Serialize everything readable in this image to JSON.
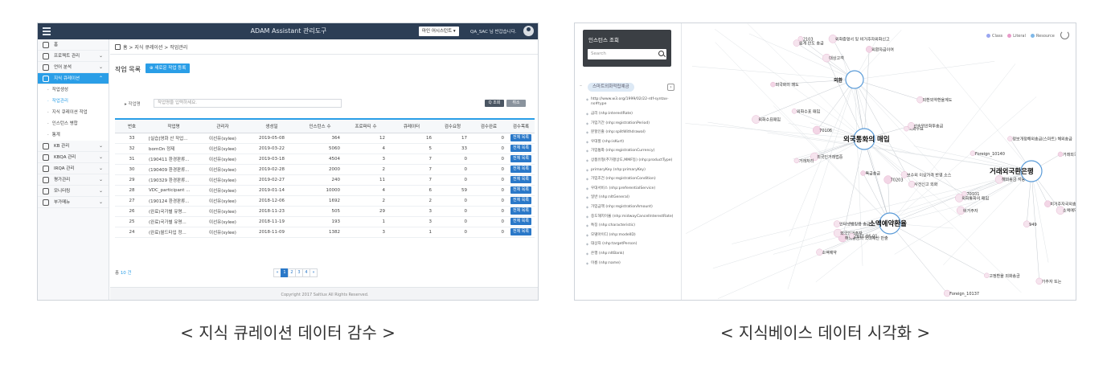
{
  "left_screen": {
    "app_title": "ADAM Assistant 관리도구",
    "assistant_select": "마인 어시스턴트 ▾",
    "user_greeting": "QA_SAC 님 반갑습니다.",
    "sidebar": [
      {
        "label": "홈",
        "chevron": ""
      },
      {
        "label": "프로젝트 관리",
        "chevron": "⌄"
      },
      {
        "label": "언어 분석",
        "chevron": "⌄"
      },
      {
        "label": "지식 큐레이션",
        "chevron": "⌃",
        "active": true
      },
      {
        "label": "작업생성",
        "sub": true
      },
      {
        "label": "작업관리",
        "sub": true,
        "current": true
      },
      {
        "label": "지식 큐레이션 작업",
        "sub": true
      },
      {
        "label": "인스턴스 병합",
        "sub": true
      },
      {
        "label": "통계",
        "sub": true
      },
      {
        "label": "KB 관리",
        "chevron": "⌄"
      },
      {
        "label": "KBQA 관리",
        "chevron": "⌄"
      },
      {
        "label": "IRQA 관리",
        "chevron": "⌄"
      },
      {
        "label": "평가관리",
        "chevron": "⌄"
      },
      {
        "label": "모니터링",
        "chevron": "⌄"
      },
      {
        "label": "부가메뉴",
        "chevron": "⌄"
      }
    ],
    "breadcrumb": "홈 > 지식 큐레이션 > 작업관리",
    "page_title": "작업 목록",
    "new_button": "⊕ 새로운 작업 등록",
    "filter_label": "작업명",
    "filter_placeholder": "작업명을 입력하세요.",
    "search_button": "Q 조회",
    "cancel_button": "취소",
    "table_headers": [
      "번호",
      "작업명",
      "관리자",
      "생성일",
      "인스턴스 수",
      "프로퍼티 수",
      "큐레이터",
      "검수요청",
      "검수완료",
      "검수목록"
    ],
    "rows": [
      [
        "33",
        "[실습]영화 산 작업...",
        "이선유(sylee)",
        "2019-05-08",
        "364",
        "12",
        "16",
        "17",
        "0",
        "전체 목록"
      ],
      [
        "32",
        "bornOn 정제",
        "이선유(sylee)",
        "2019-03-22",
        "5060",
        "4",
        "5",
        "33",
        "0",
        "전체 목록"
      ],
      [
        "31",
        "(190411 환경판류...",
        "이선유(sylee)",
        "2019-03-18",
        "4504",
        "3",
        "7",
        "0",
        "0",
        "전체 목록"
      ],
      [
        "30",
        "(190409 환경판류...",
        "이선유(sylee)",
        "2019-02-28",
        "2000",
        "2",
        "7",
        "0",
        "0",
        "전체 목록"
      ],
      [
        "29",
        "(190329 환경판류...",
        "이선유(sylee)",
        "2019-02-27",
        "240",
        "11",
        "7",
        "0",
        "0",
        "전체 목록"
      ],
      [
        "28",
        "VDC_participant ...",
        "이선유(sylee)",
        "2019-01-14",
        "10000",
        "4",
        "6",
        "59",
        "0",
        "전체 목록"
      ],
      [
        "27",
        "(190124 환경판류...",
        "이선유(sylee)",
        "2018-12-06",
        "1692",
        "2",
        "2",
        "0",
        "0",
        "전체 목록"
      ],
      [
        "26",
        "(완료)국가별 유명...",
        "이선유(sylee)",
        "2018-11-23",
        "505",
        "29",
        "3",
        "0",
        "0",
        "전체 목록"
      ],
      [
        "25",
        "(완료)국가별 유명...",
        "이선유(sylee)",
        "2018-11-19",
        "193",
        "1",
        "3",
        "0",
        "0",
        "전체 목록"
      ],
      [
        "24",
        "(완료)월드타입 정...",
        "이선유(sylee)",
        "2018-11-09",
        "1382",
        "3",
        "1",
        "0",
        "0",
        "전체 목록"
      ]
    ],
    "total_prefix": "총",
    "total_count": "10 건",
    "pager": [
      "«",
      "1",
      "2",
      "3",
      "4",
      "»"
    ],
    "footer": "Copyright 2017 Saltlux All Rights Reserved."
  },
  "right_screen": {
    "search_title": "인스턴스 조회",
    "search_placeholder": "Search",
    "class_pill": "스마트외화적립예금",
    "class_arrow": "›",
    "properties": [
      "http://www.w3.org/1999/02/22-rdf-syntax-ns#type",
      "금리 (nhp:interestRate)",
      "가입기간 (nhp:registrationPeriod)",
      "분할인출 (nhp:splitWithdrawal)",
      "우대할 (nhp:isKurt)",
      "가입통화 (nhp:registrationCurrency)",
      "상품유형(추가평상도,MMF등) (nhp:productType)",
      "primaryKey (nhp:primaryKey)",
      "가입조건 (nhp:registrationCondition)",
      "우대서비스 (nhp:preferentialService)",
      "일반 (nhp:nltGeneral)",
      "가입금액 (nhp:registrationAmount)",
      "중도해지이율 (nhp:midwayCancelInterestRate)",
      "특징 (nhp:characteristic)",
      "모델아이디 (nhp:modelID)",
      "대상자 (nhp:targetPerson)",
      "은행 (nhp:nltBank)",
      "이름 (nhp:name)"
    ],
    "legend": [
      {
        "label": "Class",
        "color": "#9aa6f0"
      },
      {
        "label": "Literal",
        "color": "#e89ac8"
      },
      {
        "label": "Resource",
        "color": "#7fb8e8"
      }
    ],
    "hubs": [
      "외환",
      "외국통화의 매입",
      "거래외국환은행",
      "소액예약환율"
    ],
    "graph_labels": [
      "외국화의 매도",
      "보수외 이상가격 반영 소스",
      "외화통화의 매입",
      "고정환율 외화송금",
      "쉽게 안도 송금",
      "해외송금의 국내예산 반출",
      "정보개정해외송금(스마트) 해외송금",
      "인터넷뱅킹용 송금",
      "외화증명서 및 비거주자외화신고",
      "외화수표 매입",
      "비거주자국외송금",
      "해외송금 자동이체",
      "외화수표",
      "산속위안화투송금",
      "비거주자",
      "특급송금",
      "사건신고 외화",
      "외국인거래법중",
      "Foreign_10140",
      "Foreign_10137",
      "70106",
      "70101",
      "가추자 또는",
      "외국인거주자",
      "2103",
      "외환자금이여",
      "소액예약 ...",
      "2011-06-01",
      "외환외약환율계도",
      "대상고객",
      "거래외국화은행",
      "소액예약",
      "외화수표매입",
      "거래처리",
      "949",
      "70203"
    ]
  },
  "captions": {
    "left": "< 지식 큐레이션 데이터 감수 >",
    "right": "< 지식베이스 데이터 시각화 >"
  }
}
